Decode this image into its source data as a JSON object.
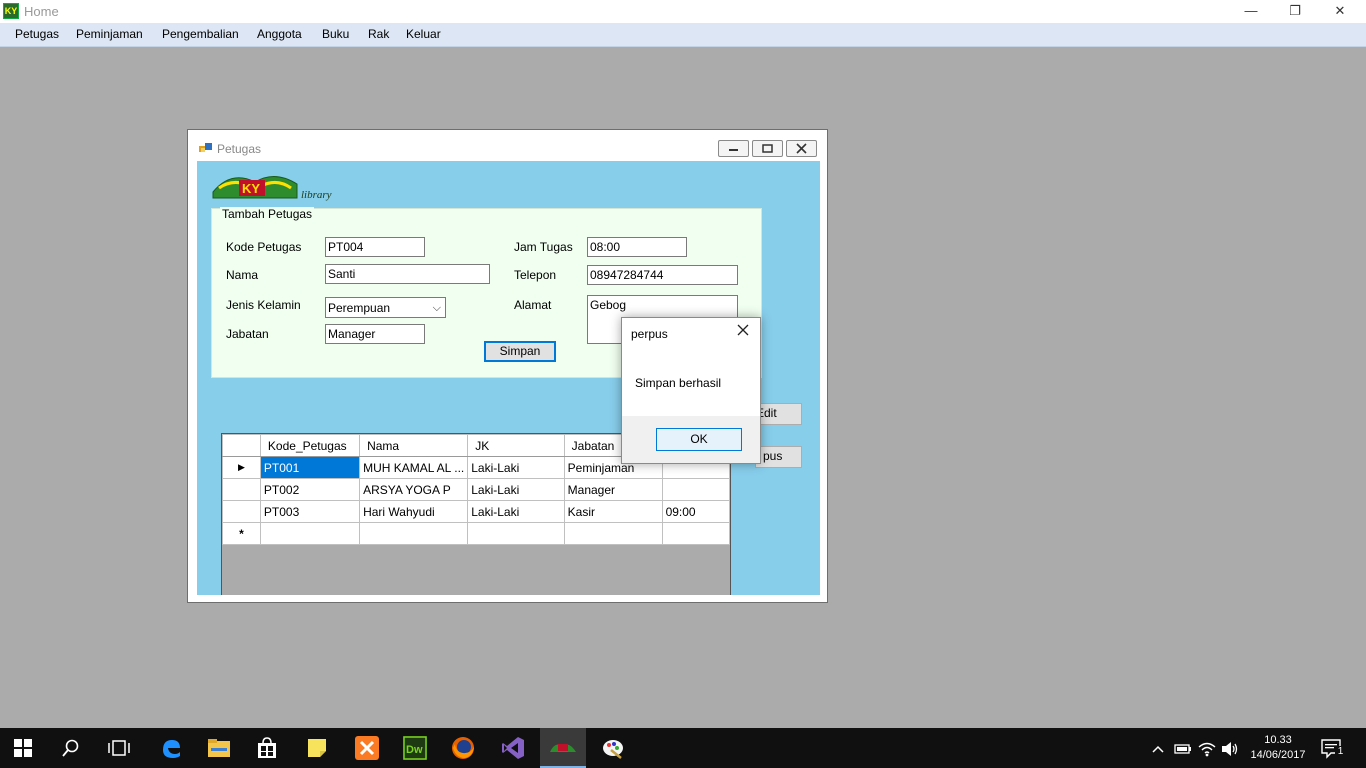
{
  "window": {
    "title": "Home",
    "minimize": "—",
    "restore": "❐",
    "close": "✕"
  },
  "menu": [
    "Petugas",
    "Peminjaman",
    "Pengembalian",
    "Anggota",
    "Buku",
    "Rak",
    "Keluar"
  ],
  "child": {
    "title": "Petugas",
    "logo_text": "KY",
    "logo_tagline": "library"
  },
  "form": {
    "group_title": "Tambah Petugas",
    "kode_label": "Kode Petugas",
    "kode_value": "PT004",
    "nama_label": "Nama",
    "nama_value": "Santi",
    "jk_label": "Jenis Kelamin",
    "jk_value": "Perempuan",
    "jabatan_label": "Jabatan",
    "jabatan_value": "Manager",
    "jam_label": "Jam Tugas",
    "jam_value": "08:00",
    "telepon_label": "Telepon",
    "telepon_value": "08947284744",
    "alamat_label": "Alamat",
    "alamat_value": "Gebog",
    "simpan_label": "Simpan"
  },
  "side_buttons": {
    "edit_label": "Edit",
    "hapus_label": "pus"
  },
  "grid": {
    "headers": [
      "Kode_Petugas",
      "Nama",
      "JK",
      "Jabatan",
      ""
    ],
    "rows": [
      [
        "PT001",
        "MUH KAMAL AL ...",
        "Laki-Laki",
        "Peminjaman",
        ""
      ],
      [
        "PT002",
        "ARSYA YOGA P",
        "Laki-Laki",
        "Manager",
        ""
      ],
      [
        "PT003",
        "Hari Wahyudi",
        "Laki-Laki",
        "Kasir",
        "09:00"
      ]
    ],
    "current_row_marker": "▶",
    "new_row_marker": "*"
  },
  "messagebox": {
    "title": "perpus",
    "message": "Simpan berhasil",
    "ok_label": "OK"
  },
  "taskbar": {
    "time": "10.33",
    "date": "14/06/2017",
    "notification_count": "1"
  },
  "colors": {
    "menu_bg": "#dce6f4",
    "panel_bg": "#87ceeb",
    "group_bg": "#f0fff0",
    "selection": "#0078d7",
    "mdi_bg": "#ababab",
    "taskbar_bg": "#101010"
  }
}
